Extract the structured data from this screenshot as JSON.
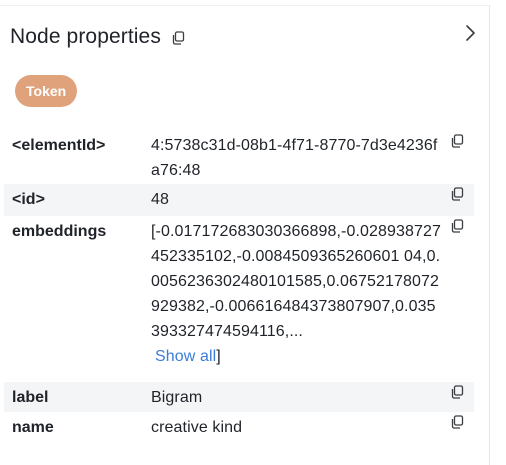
{
  "panel": {
    "title": "Node properties",
    "badge": "Token"
  },
  "properties": [
    {
      "key": "<elementId>",
      "value": "4:5738c31d-08b1-4f71-8770-7d3e4236fa76:48"
    },
    {
      "key": "<id>",
      "value": "48"
    },
    {
      "key": "embeddings",
      "value": "[-0.017172683030366898,-0.028938727452335102,-0.0084509365260601 04,0.0056236302480101585,0.06752178072929382,-0.006616484373807907,0.035393327474594116,...",
      "show_all": "Show all",
      "close_bracket": "]"
    },
    {
      "key": "label",
      "value": "Bigram"
    },
    {
      "key": "name",
      "value": "creative kind"
    }
  ],
  "icons": {
    "copy": "copy-icon",
    "chevron": "chevron-right-icon"
  },
  "colors": {
    "badge": "#e0a27b",
    "link": "#3b7dd8",
    "row_alt": "#f4f5f6"
  }
}
